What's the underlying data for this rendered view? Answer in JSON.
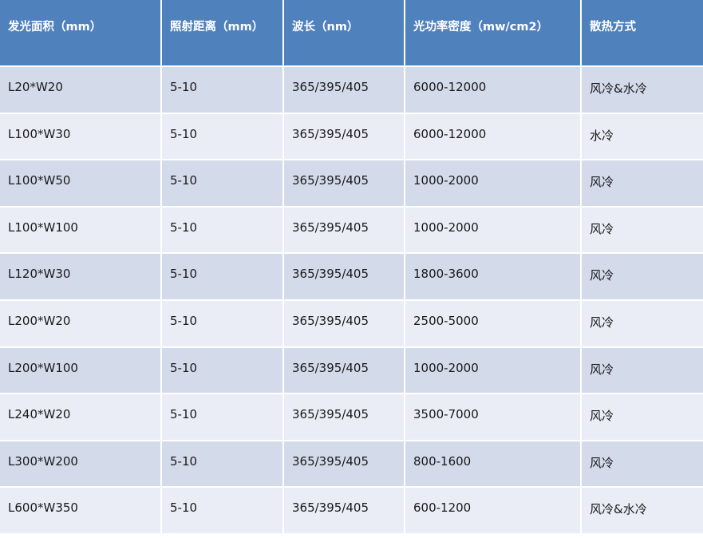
{
  "table": {
    "headers": [
      "发光面积（mm）",
      "照射距离（mm）",
      "波长（nm）",
      "光功率密度（mw/cm2）",
      "散热方式"
    ],
    "rows": [
      [
        "L20*W20",
        "5-10",
        "365/395/405",
        "6000-12000",
        "风冷&水冷"
      ],
      [
        "L100*W30",
        "5-10",
        "365/395/405",
        "6000-12000",
        "水冷"
      ],
      [
        "L100*W50",
        "5-10",
        "365/395/405",
        "1000-2000",
        "风冷"
      ],
      [
        "L100*W100",
        "5-10",
        "365/395/405",
        "1000-2000",
        "风冷"
      ],
      [
        "L120*W30",
        "5-10",
        "365/395/405",
        "1800-3600",
        "风冷"
      ],
      [
        "L200*W20",
        "5-10",
        "365/395/405",
        "2500-5000",
        "风冷"
      ],
      [
        "L200*W100",
        "5-10",
        "365/395/405",
        "1000-2000",
        "风冷"
      ],
      [
        "L240*W20",
        "5-10",
        "365/395/405",
        "3500-7000",
        "风冷"
      ],
      [
        "L300*W200",
        "5-10",
        "365/395/405",
        "800-1600",
        "风冷"
      ],
      [
        "L600*W350",
        "5-10",
        "365/395/405",
        "600-1200",
        "风冷&水冷"
      ]
    ]
  },
  "colors": {
    "header_bg": "#4f81bd",
    "row_odd_bg": "#d3daea",
    "row_even_bg": "#eaedf6",
    "header_text": "#ffffff",
    "body_text": "#1a1a1a"
  }
}
